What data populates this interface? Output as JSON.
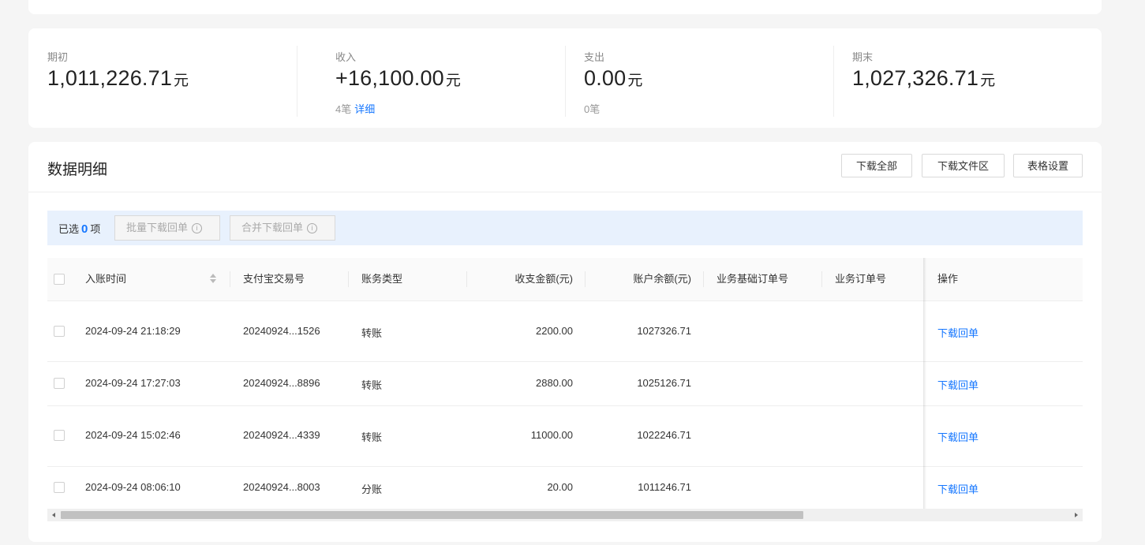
{
  "summary": {
    "opening": {
      "label": "期初",
      "amount": "1,011,226.71",
      "unit": "元"
    },
    "income": {
      "label": "收入",
      "amount": "+16,100.00",
      "unit": "元",
      "count": "4笔",
      "detail_link": "详细"
    },
    "expense": {
      "label": "支出",
      "amount": "0.00",
      "unit": "元",
      "count": "0笔"
    },
    "closing": {
      "label": "期末",
      "amount": "1,027,326.71",
      "unit": "元"
    }
  },
  "detail": {
    "title": "数据明细",
    "buttons": {
      "download_all": "下载全部",
      "download_files": "下载文件区",
      "table_settings": "表格设置"
    }
  },
  "selection": {
    "prefix": "已选",
    "count": "0",
    "suffix": "项",
    "batch_download": "批量下载回单",
    "merge_download": "合并下载回单"
  },
  "table": {
    "columns": {
      "time": "入账时间",
      "trade_no": "支付宝交易号",
      "type": "账务类型",
      "amount": "收支金额(元)",
      "balance": "账户余额(元)",
      "base_order": "业务基础订单号",
      "order": "业务订单号",
      "action": "操作"
    },
    "rows": [
      {
        "time": "2024-09-24 21:18:29",
        "trade_no": "20240924...1526",
        "type": "转账",
        "amount": "2200.00",
        "balance": "1027326.71",
        "action": "下载回单"
      },
      {
        "time": "2024-09-24 17:27:03",
        "trade_no": "20240924...8896",
        "type": "转账",
        "amount": "2880.00",
        "balance": "1025126.71",
        "action": "下载回单"
      },
      {
        "time": "2024-09-24 15:02:46",
        "trade_no": "20240924...4339",
        "type": "转账",
        "amount": "11000.00",
        "balance": "1022246.71",
        "action": "下载回单"
      },
      {
        "time": "2024-09-24 08:06:10",
        "trade_no": "20240924...8003",
        "type": "分账",
        "amount": "20.00",
        "balance": "1011246.71",
        "action": "下载回单"
      }
    ]
  },
  "icons": {
    "info": "info-circle-icon",
    "sort": "sort-icon"
  },
  "colors": {
    "accent": "#1677ff",
    "selection_bg": "#e8f1fd"
  }
}
